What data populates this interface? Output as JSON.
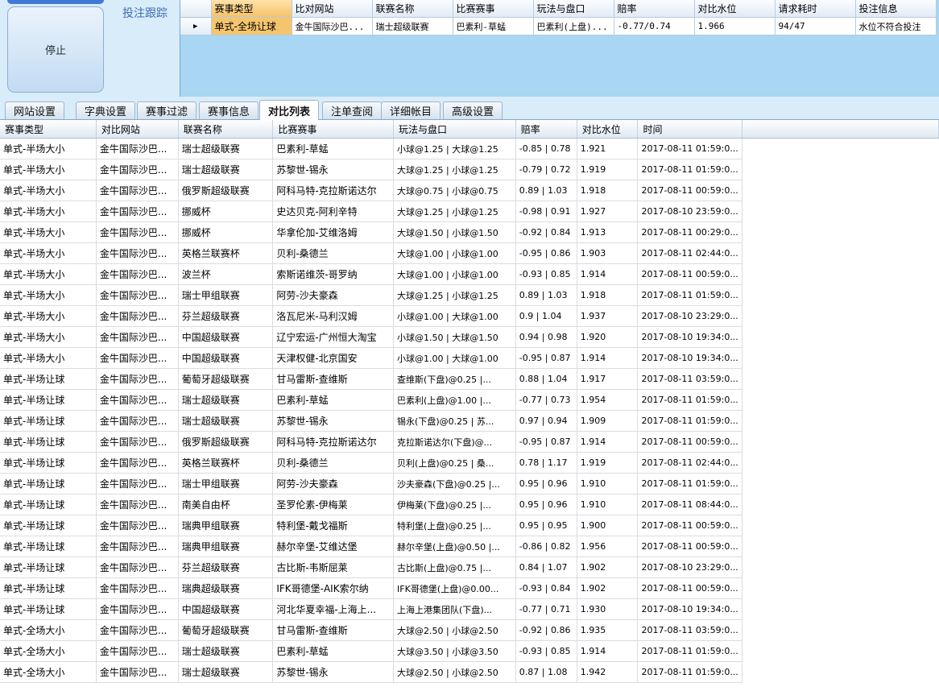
{
  "control": {
    "stop_label": "停止",
    "track_label": "投注跟踪"
  },
  "bet_track": {
    "columns": [
      "赛事类型",
      "比对网站",
      "联赛名称",
      "比赛赛事",
      "玩法与盘口",
      "赔率",
      "对比水位",
      "请求耗时",
      "投注信息"
    ],
    "rows": [
      [
        "单式-全场让球",
        "金牛国际沙巴...",
        "瑞士超级联赛",
        "巴素利-草蜢",
        "巴素利(上盘)...",
        "-0.77/0.74",
        "1.966",
        "94/47",
        "水位不符合投注"
      ]
    ]
  },
  "tabs": [
    {
      "label": "网站设置",
      "active": false
    },
    {
      "label": "字典设置",
      "active": false
    },
    {
      "label": "赛事过滤",
      "active": false
    },
    {
      "label": "赛事信息",
      "active": false
    },
    {
      "label": "对比列表",
      "active": true
    },
    {
      "label": "注单查阅",
      "active": false
    },
    {
      "label": "详细帐目",
      "active": false
    },
    {
      "label": "高级设置",
      "active": false
    }
  ],
  "compare_table": {
    "columns": [
      "赛事类型",
      "对比网站",
      "联赛名称",
      "比赛赛事",
      "玩法与盘口",
      "赔率",
      "对比水位",
      "时间"
    ],
    "rows": [
      [
        "单式-半场大小",
        "金牛国际沙巴...",
        "瑞士超级联赛",
        "巴素利-草蜢",
        "小球@1.25 | 大球@1.25",
        "-0.85 | 0.78",
        "1.921",
        "2017-08-11 01:59:0..."
      ],
      [
        "单式-半场大小",
        "金牛国际沙巴...",
        "瑞士超级联赛",
        "苏黎世-锡永",
        "大球@1.25 | 小球@1.25",
        "-0.79 | 0.72",
        "1.919",
        "2017-08-11 01:59:0..."
      ],
      [
        "单式-半场大小",
        "金牛国际沙巴...",
        "俄罗斯超级联赛",
        "阿科马特-克拉斯诺达尔",
        "大球@0.75 | 小球@0.75",
        "0.89 | 1.03",
        "1.918",
        "2017-08-11 00:59:0..."
      ],
      [
        "单式-半场大小",
        "金牛国际沙巴...",
        "挪威杯",
        "史达贝克-阿利辛特",
        "大球@1.25 | 小球@1.25",
        "-0.98 | 0.91",
        "1.927",
        "2017-08-10 23:59:0..."
      ],
      [
        "单式-半场大小",
        "金牛国际沙巴...",
        "挪威杯",
        "华拿伦加-艾维洛姆",
        "大球@1.50 | 小球@1.50",
        "-0.92 | 0.84",
        "1.913",
        "2017-08-11 00:29:0..."
      ],
      [
        "单式-半场大小",
        "金牛国际沙巴...",
        "英格兰联赛杯",
        "贝利-桑德兰",
        "大球@1.00 | 小球@1.00",
        "-0.95 | 0.86",
        "1.903",
        "2017-08-11 02:44:0..."
      ],
      [
        "单式-半场大小",
        "金牛国际沙巴...",
        "波兰杯",
        "索斯诺维茨-哥罗纳",
        "大球@1.00 | 小球@1.00",
        "-0.93 | 0.85",
        "1.914",
        "2017-08-11 00:59:0..."
      ],
      [
        "单式-半场大小",
        "金牛国际沙巴...",
        "瑞士甲组联赛",
        "阿劳-沙夫豪森",
        "大球@1.25 | 小球@1.25",
        "0.89 | 1.03",
        "1.918",
        "2017-08-11 01:59:0..."
      ],
      [
        "单式-半场大小",
        "金牛国际沙巴...",
        "芬兰超级联赛",
        "洛瓦尼米-马利汉姆",
        "小球@1.00 | 大球@1.00",
        "0.9 | 1.04",
        "1.937",
        "2017-08-10 23:29:0..."
      ],
      [
        "单式-半场大小",
        "金牛国际沙巴...",
        "中国超级联赛",
        "辽宁宏运-广州恒大淘宝",
        "小球@1.50 | 大球@1.50",
        "0.94 | 0.98",
        "1.920",
        "2017-08-10 19:34:0..."
      ],
      [
        "单式-半场大小",
        "金牛国际沙巴...",
        "中国超级联赛",
        "天津权健-北京国安",
        "小球@1.00 | 大球@1.00",
        "-0.95 | 0.87",
        "1.914",
        "2017-08-10 19:34:0..."
      ],
      [
        "单式-半场让球",
        "金牛国际沙巴...",
        "葡萄牙超级联赛",
        "甘马雷斯-查维斯",
        "查维斯(下盘)@0.25 |...",
        "0.88 | 1.04",
        "1.917",
        "2017-08-11 03:59:0..."
      ],
      [
        "单式-半场让球",
        "金牛国际沙巴...",
        "瑞士超级联赛",
        "巴素利-草蜢",
        "巴素利(上盘)@1.00 |...",
        "-0.77 | 0.73",
        "1.954",
        "2017-08-11 01:59:0..."
      ],
      [
        "单式-半场让球",
        "金牛国际沙巴...",
        "瑞士超级联赛",
        "苏黎世-锡永",
        "锡永(下盘)@0.25 | 苏...",
        "0.97 | 0.94",
        "1.909",
        "2017-08-11 01:59:0..."
      ],
      [
        "单式-半场让球",
        "金牛国际沙巴...",
        "俄罗斯超级联赛",
        "阿科马特-克拉斯诺达尔",
        "克拉斯诺达尔(下盘)@...",
        "-0.95 | 0.87",
        "1.914",
        "2017-08-11 00:59:0..."
      ],
      [
        "单式-半场让球",
        "金牛国际沙巴...",
        "英格兰联赛杯",
        "贝利-桑德兰",
        "贝利(上盘)@0.25 | 桑...",
        "0.78 | 1.17",
        "1.919",
        "2017-08-11 02:44:0..."
      ],
      [
        "单式-半场让球",
        "金牛国际沙巴...",
        "瑞士甲组联赛",
        "阿劳-沙夫豪森",
        "沙夫豪森(下盘)@0.25 |...",
        "0.95 | 0.96",
        "1.910",
        "2017-08-11 01:59:0..."
      ],
      [
        "单式-半场让球",
        "金牛国际沙巴...",
        "南美自由杯",
        "圣罗伦素-伊梅莱",
        "伊梅莱(下盘)@0.25 |...",
        "0.95 | 0.96",
        "1.910",
        "2017-08-11 08:44:0..."
      ],
      [
        "单式-半场让球",
        "金牛国际沙巴...",
        "瑞典甲组联赛",
        "特利堡-戴戈福斯",
        "特利堡(上盘)@0.25 |...",
        "0.95 | 0.95",
        "1.900",
        "2017-08-11 00:59:0..."
      ],
      [
        "单式-半场让球",
        "金牛国际沙巴...",
        "瑞典甲组联赛",
        "赫尔辛堡-艾维达堡",
        "赫尔辛堡(上盘)@0.50 |...",
        "-0.86 | 0.82",
        "1.956",
        "2017-08-11 00:59:0..."
      ],
      [
        "单式-半场让球",
        "金牛国际沙巴...",
        "芬兰超级联赛",
        "古比斯-韦斯屈莱",
        "古比斯(上盘)@0.75 |...",
        "0.84 | 1.07",
        "1.902",
        "2017-08-10 23:29:0..."
      ],
      [
        "单式-半场让球",
        "金牛国际沙巴...",
        "瑞典超级联赛",
        "IFK哥德堡-AIK索尔纳",
        "IFK哥德堡(上盘)@0.00...",
        "-0.93 | 0.84",
        "1.902",
        "2017-08-11 00:59:0..."
      ],
      [
        "单式-半场让球",
        "金牛国际沙巴...",
        "中国超级联赛",
        "河北华夏幸福-上海上...",
        "上海上港集团队(下盘)...",
        "-0.77 | 0.71",
        "1.930",
        "2017-08-10 19:34:0..."
      ],
      [
        "单式-全场大小",
        "金牛国际沙巴...",
        "葡萄牙超级联赛",
        "甘马雷斯-查维斯",
        "大球@2.50 | 小球@2.50",
        "-0.92 | 0.86",
        "1.935",
        "2017-08-11 03:59:0..."
      ],
      [
        "单式-全场大小",
        "金牛国际沙巴...",
        "瑞士超级联赛",
        "巴素利-草蜢",
        "大球@3.50 | 小球@3.50",
        "-0.93 | 0.85",
        "1.914",
        "2017-08-11 01:59:0..."
      ],
      [
        "单式-全场大小",
        "金牛国际沙巴...",
        "瑞士超级联赛",
        "苏黎世-锡永",
        "大球@2.50 | 小球@2.50",
        "0.87 | 1.08",
        "1.942",
        "2017-08-11 01:59:0..."
      ]
    ]
  },
  "colors": {
    "background": "#d9ecf9",
    "grid_panel": "#a8d6f3",
    "selected_cell": "#f5c56e",
    "label_blue": "#3c6cb4"
  },
  "icons": {
    "row_pointer": "triangle-right-icon"
  }
}
